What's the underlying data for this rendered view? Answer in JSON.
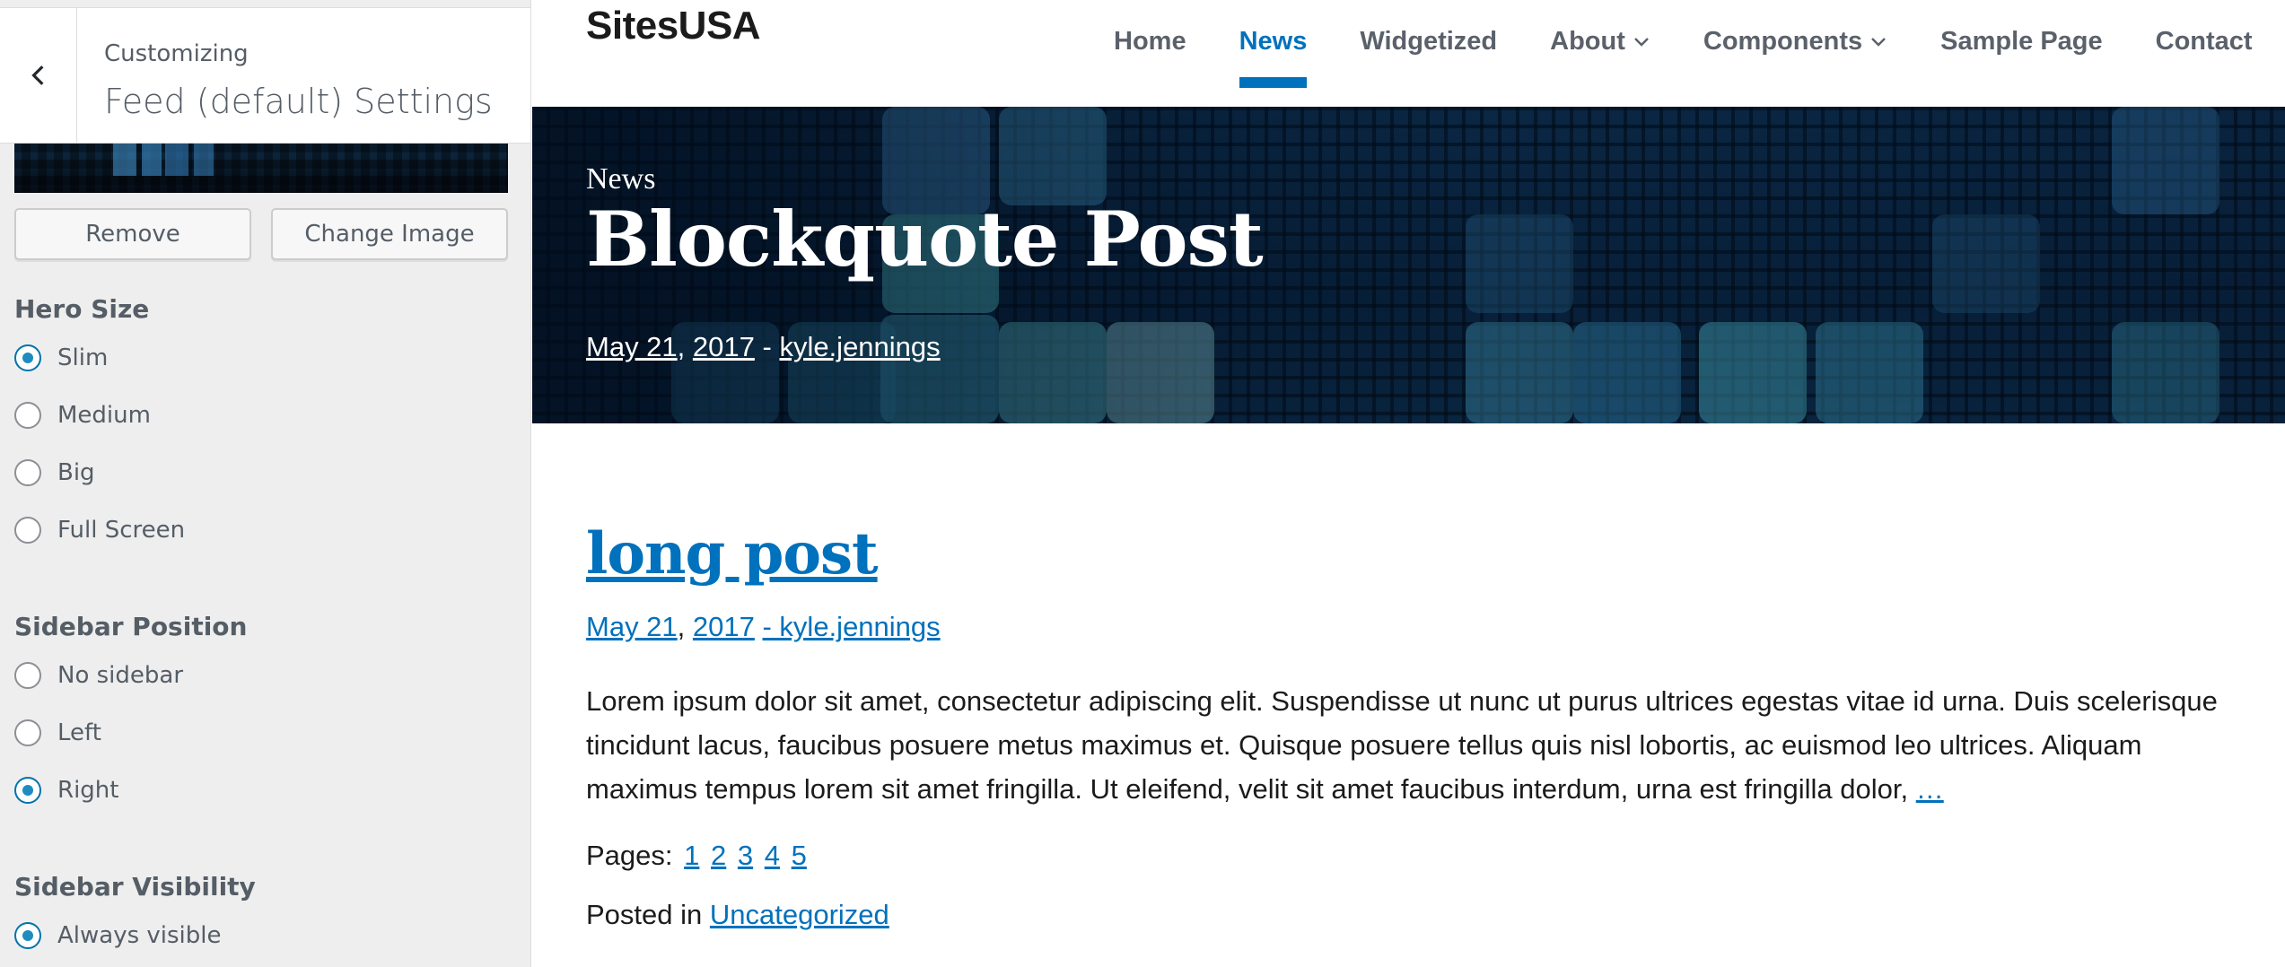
{
  "customizer": {
    "eyebrow": "Customizing",
    "title": "Feed (default) Settings",
    "buttons": {
      "remove": "Remove",
      "change_image": "Change Image"
    },
    "hero_size": {
      "label": "Hero Size",
      "options": [
        "Slim",
        "Medium",
        "Big",
        "Full Screen"
      ],
      "selected": "Slim"
    },
    "sidebar_position": {
      "label": "Sidebar Position",
      "options": [
        "No sidebar",
        "Left",
        "Right"
      ],
      "selected": "Right"
    },
    "sidebar_visibility": {
      "label": "Sidebar Visibility",
      "options": [
        "Always visible"
      ],
      "selected": "Always visible"
    },
    "accent_color": "#0073aa"
  },
  "site": {
    "name": "SitesUSA",
    "nav": [
      {
        "label": "Home"
      },
      {
        "label": "News"
      },
      {
        "label": "Widgetized"
      },
      {
        "label": "About"
      },
      {
        "label": "Components"
      },
      {
        "label": "Sample Page"
      },
      {
        "label": "Contact"
      }
    ],
    "active_nav": "News",
    "hero": {
      "section": "News",
      "title": "Blockquote Post",
      "date_day": "May 21",
      "date_year": "2017",
      "separator": " - ",
      "author": "kyle.jennings"
    },
    "post": {
      "title": "long post",
      "date_day": "May 21",
      "date_year": "2017",
      "author": "- kyle.jennings",
      "excerpt": "Lorem ipsum dolor sit amet, consectetur adipiscing elit. Suspendisse ut nunc ut purus ultrices egestas vitae id urna. Duis scelerisque tincidunt lacus, faucibus posuere metus maximus et. Quisque posuere tellus quis nisl lobortis, ac euismod leo ultrices. Aliquam maximus tempus lorem sit amet fringilla. Ut eleifend, velit sit amet faucibus interdum, urna est fringilla dolor,",
      "more_link": "…",
      "pages_label": "Pages:",
      "pages": [
        "1",
        "2",
        "3",
        "4",
        "5"
      ],
      "posted_in_label": "Posted in",
      "category": "Uncategorized"
    },
    "link_color": "#0071bc"
  }
}
